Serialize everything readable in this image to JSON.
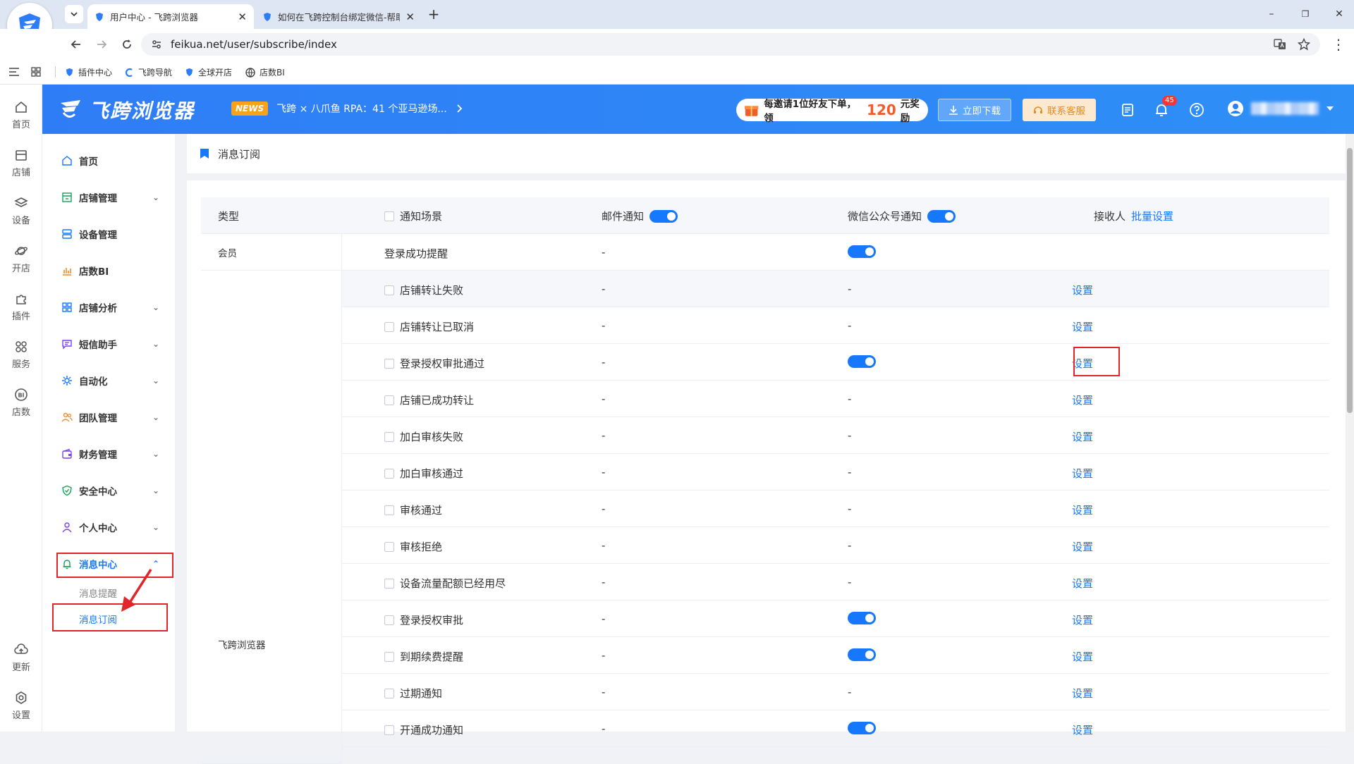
{
  "browser": {
    "tabs": [
      {
        "title": "用户中心 - 飞跨浏览器",
        "active": true
      },
      {
        "title": "如何在飞跨控制台绑定微信-帮助",
        "active": false
      }
    ],
    "new_tab": "+",
    "window_controls": [
      "–",
      "❐",
      "✕"
    ],
    "url": "feikua.net/user/subscribe/index",
    "bookmarks": [
      "插件中心",
      "飞跨导航",
      "全球开店",
      "店数BI"
    ]
  },
  "header": {
    "brand": "飞跨浏览器",
    "news_tag": "NEWS",
    "news_text": "飞跨 × 八爪鱼 RPA：41 个亚马逊场...",
    "invite_prefix": "每邀请1位好友下单，领",
    "invite_amount": "120",
    "invite_suffix": "元奖励",
    "download_label": "立即下载",
    "service_label": "联系客服",
    "notification_count": "45"
  },
  "rail": {
    "items": [
      "首页",
      "店铺",
      "设备",
      "开店",
      "插件",
      "服务",
      "店数"
    ],
    "bottom": [
      "更新",
      "设置"
    ]
  },
  "sidebar": {
    "items": [
      {
        "label": "首页",
        "icon": "home-icon"
      },
      {
        "label": "店铺管理",
        "icon": "store-icon"
      },
      {
        "label": "设备管理",
        "icon": "server-icon"
      },
      {
        "label": "店数BI",
        "icon": "chart-icon"
      },
      {
        "label": "店铺分析",
        "icon": "grid-icon"
      },
      {
        "label": "短信助手",
        "icon": "message-icon"
      },
      {
        "label": "自动化",
        "icon": "gear-icon"
      },
      {
        "label": "团队管理",
        "icon": "team-icon"
      },
      {
        "label": "财务管理",
        "icon": "wallet-icon"
      },
      {
        "label": "安全中心",
        "icon": "shield-icon"
      },
      {
        "label": "个人中心",
        "icon": "user-icon"
      },
      {
        "label": "消息中心",
        "icon": "bell-icon"
      }
    ],
    "sub_items": [
      "消息提醒",
      "消息订阅"
    ]
  },
  "page": {
    "title": "消息订阅"
  },
  "table": {
    "headers": {
      "type": "类型",
      "scene": "通知场景",
      "email": "邮件通知",
      "wechat": "微信公众号通知",
      "receiver": "接收人",
      "batch": "批量设置"
    },
    "groups": [
      "会员",
      "飞跨浏览器"
    ],
    "rows": [
      {
        "scene": "登录成功提醒",
        "email": "-",
        "wechat": "on",
        "receiver": "",
        "checkbox": false
      },
      {
        "scene": "店铺转让失败",
        "email": "-",
        "wechat": "-",
        "receiver": "设置",
        "checkbox": true
      },
      {
        "scene": "店铺转让已取消",
        "email": "-",
        "wechat": "-",
        "receiver": "设置",
        "checkbox": true
      },
      {
        "scene": "登录授权审批通过",
        "email": "-",
        "wechat": "on",
        "receiver": "设置",
        "checkbox": true
      },
      {
        "scene": "店铺已成功转让",
        "email": "-",
        "wechat": "-",
        "receiver": "设置",
        "checkbox": true
      },
      {
        "scene": "加白审核失败",
        "email": "-",
        "wechat": "-",
        "receiver": "设置",
        "checkbox": true
      },
      {
        "scene": "加白审核通过",
        "email": "-",
        "wechat": "-",
        "receiver": "设置",
        "checkbox": true
      },
      {
        "scene": "审核通过",
        "email": "-",
        "wechat": "-",
        "receiver": "设置",
        "checkbox": true
      },
      {
        "scene": "审核拒绝",
        "email": "-",
        "wechat": "-",
        "receiver": "设置",
        "checkbox": true
      },
      {
        "scene": "设备流量配额已经用尽",
        "email": "-",
        "wechat": "-",
        "receiver": "设置",
        "checkbox": true
      },
      {
        "scene": "登录授权审批",
        "email": "-",
        "wechat": "on",
        "receiver": "设置",
        "checkbox": true
      },
      {
        "scene": "到期续费提醒",
        "email": "-",
        "wechat": "on",
        "receiver": "设置",
        "checkbox": true
      },
      {
        "scene": "过期通知",
        "email": "-",
        "wechat": "-",
        "receiver": "设置",
        "checkbox": true
      },
      {
        "scene": "开通成功通知",
        "email": "-",
        "wechat": "on",
        "receiver": "设置",
        "checkbox": true
      }
    ]
  },
  "colors": {
    "primary": "#1677ff",
    "highlight": "#e0262a"
  }
}
